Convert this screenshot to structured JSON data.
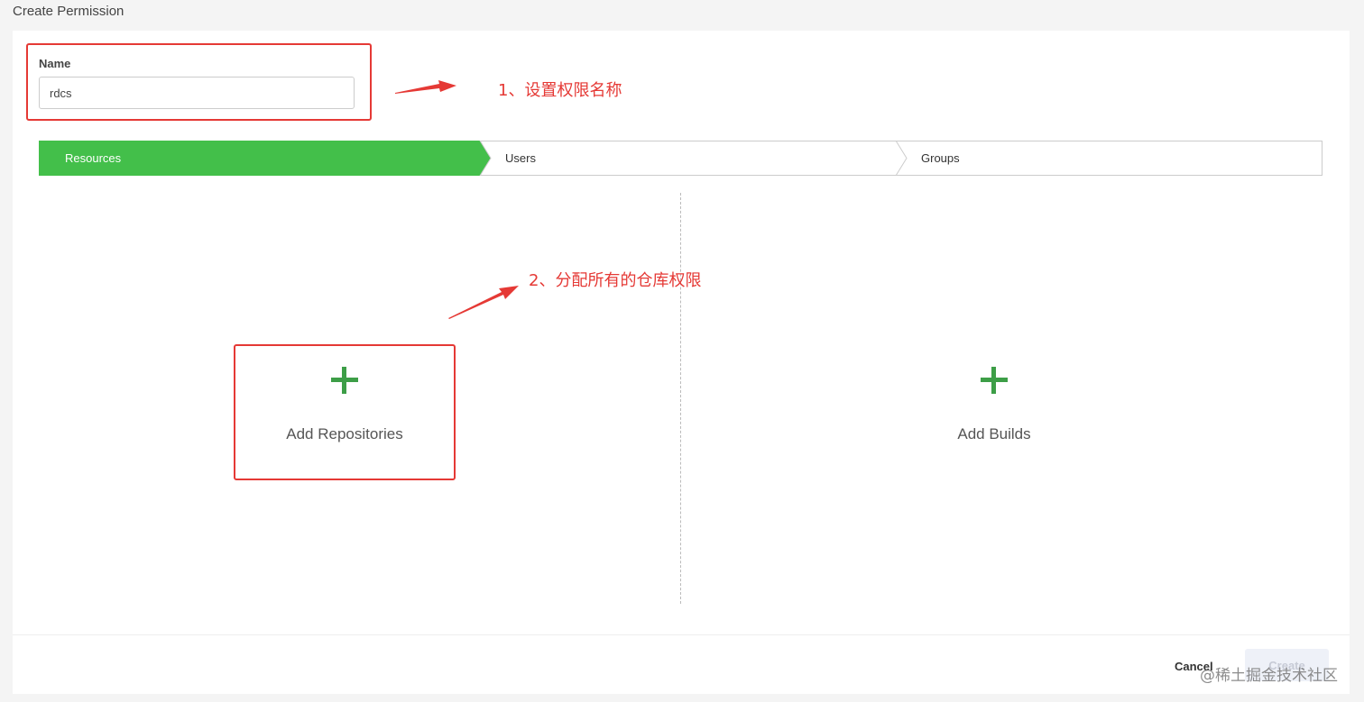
{
  "page": {
    "title": "Create Permission"
  },
  "form": {
    "name_label": "Name",
    "name_value": "rdcs"
  },
  "steps": [
    {
      "label": "Resources",
      "active": true
    },
    {
      "label": "Users",
      "active": false
    },
    {
      "label": "Groups",
      "active": false
    }
  ],
  "resources": {
    "add_repositories_label": "Add Repositories",
    "add_builds_label": "Add Builds"
  },
  "annotations": {
    "step1": "1、设置权限名称",
    "step2": "2、分配所有的仓库权限"
  },
  "footer": {
    "cancel_label": "Cancel",
    "create_label": "Create"
  },
  "watermark": "@稀土掘金技术社区",
  "colors": {
    "accent_green": "#43bf4a",
    "plus_green": "#3d9e47",
    "annotation_red": "#e53935"
  }
}
